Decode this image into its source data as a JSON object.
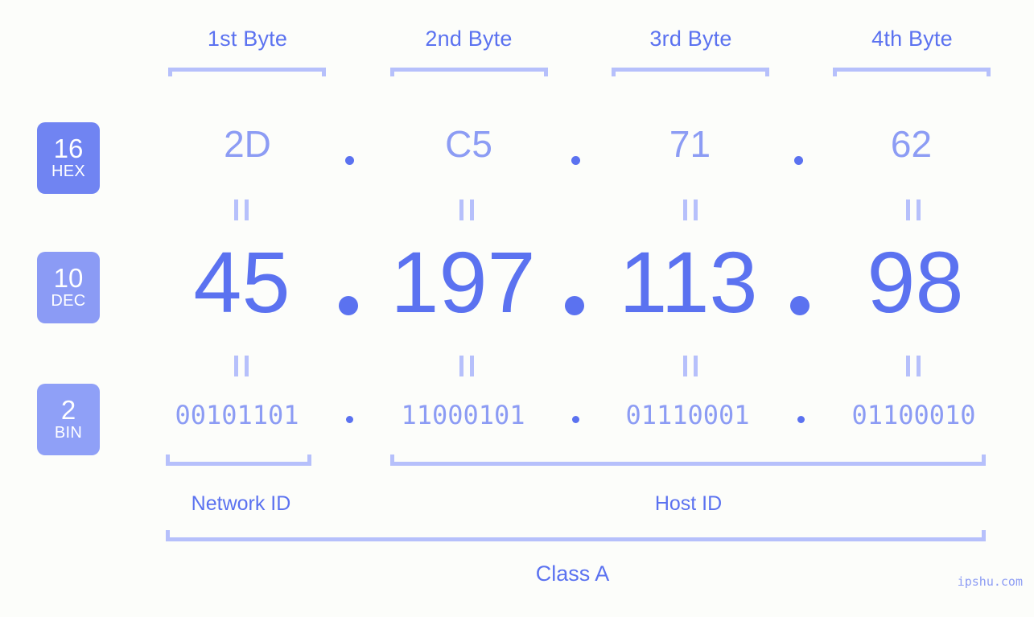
{
  "background_color": "#fcfdfa",
  "accent_color": "#5b72f0",
  "accent_light_color": "#8c9cf4",
  "bracket_color": "#b6c0fb",
  "ip_address": "45.197.113.98",
  "byte_headers": [
    {
      "label": "1st Byte"
    },
    {
      "label": "2nd Byte"
    },
    {
      "label": "3rd Byte"
    },
    {
      "label": "4th Byte"
    }
  ],
  "bases": [
    {
      "number": "16",
      "abbr": "HEX",
      "color": "#7084f2"
    },
    {
      "number": "10",
      "abbr": "DEC",
      "color": "#8b9bf5"
    },
    {
      "number": "2",
      "abbr": "BIN",
      "color": "#8fa0f7"
    }
  ],
  "rows": {
    "hex": {
      "values": [
        "2D",
        "C5",
        "71",
        "62"
      ],
      "separator": "."
    },
    "dec": {
      "values": [
        "45",
        "197",
        "113",
        "98"
      ],
      "separator": "."
    },
    "bin": {
      "values": [
        "00101101",
        "11000101",
        "01110001",
        "01100010"
      ],
      "separator": "."
    }
  },
  "equals_marks": {
    "symbol": "=",
    "count": 8
  },
  "sections": [
    {
      "label": "Network ID"
    },
    {
      "label": "Host ID"
    }
  ],
  "class": {
    "label": "Class A"
  },
  "watermark": {
    "text": "ipshu.com"
  }
}
